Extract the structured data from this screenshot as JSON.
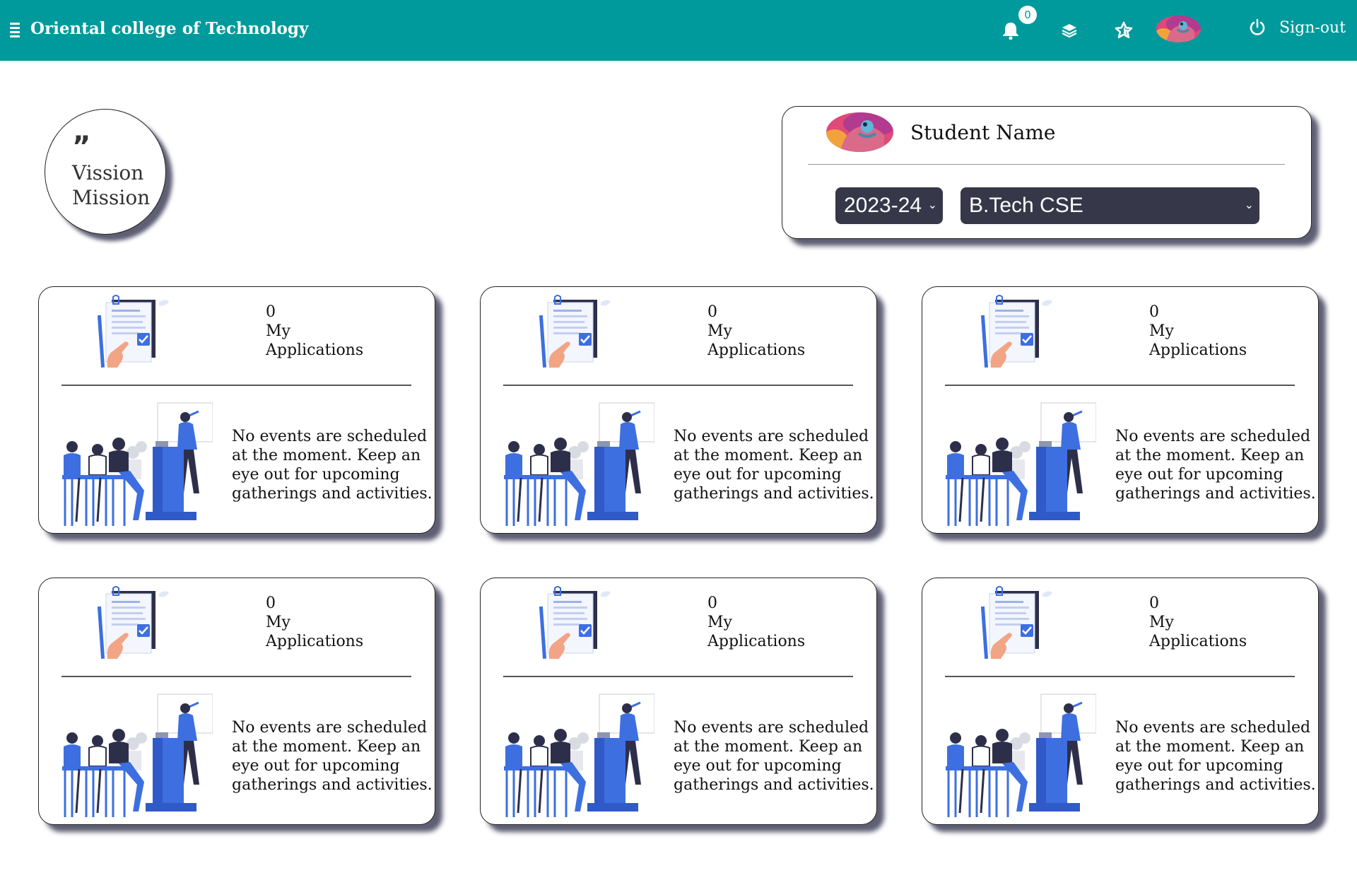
{
  "navbar": {
    "brand": "Oriental college of Technology",
    "notification_count": "0",
    "signout_label": "Sign-out",
    "icons": [
      "menu-icon",
      "bell-icon",
      "layers-icon",
      "star-icon",
      "avatar",
      "power-icon"
    ],
    "background": "#009a9c"
  },
  "vision": {
    "quote": "”",
    "line1": "Vission",
    "line2": "Mission"
  },
  "student": {
    "name": "Student Name",
    "year": "2023-24",
    "course": "B.Tech CSE"
  },
  "cards": [
    {
      "count": "0",
      "label": "My Applications",
      "event_text": "No events are scheduled at the moment. Keep an eye out for upcoming gatherings and activities."
    },
    {
      "count": "0",
      "label": "My Applications",
      "event_text": "No events are scheduled at the moment. Keep an eye out for upcoming gatherings and activities."
    },
    {
      "count": "0",
      "label": "My Applications",
      "event_text": "No events are scheduled at the moment. Keep an eye out for upcoming gatherings and activities."
    },
    {
      "count": "0",
      "label": "My Applications",
      "event_text": "No events are scheduled at the moment. Keep an eye out for upcoming gatherings and activities."
    },
    {
      "count": "0",
      "label": "My Applications",
      "event_text": "No events are scheduled at the moment. Keep an eye out for upcoming gatherings and activities."
    },
    {
      "count": "0",
      "label": "My Applications",
      "event_text": "No events are scheduled at the moment. Keep an eye out for upcoming gatherings and activities."
    }
  ],
  "colors": {
    "accent": "#009a9c",
    "select_bg": "#363849",
    "illustration_blue": "#3d6fe0"
  }
}
